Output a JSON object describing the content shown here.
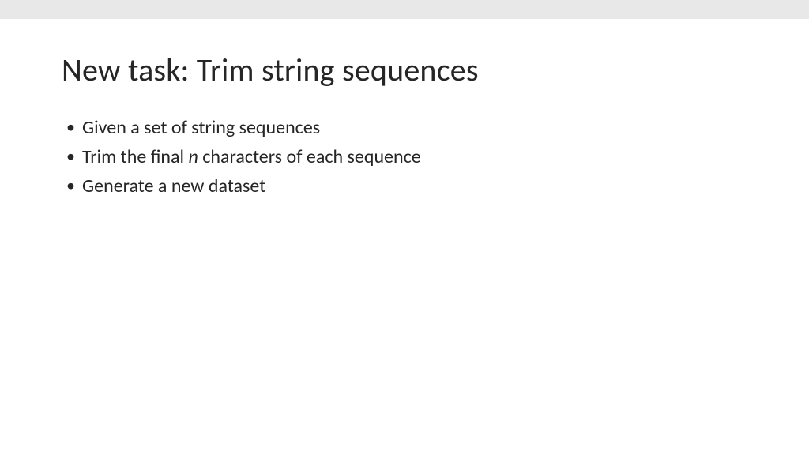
{
  "slide": {
    "title": "New task: Trim string sequences",
    "bullets": [
      {
        "textBefore": "Given a set of string sequences",
        "var": "",
        "textAfter": ""
      },
      {
        "textBefore": "Trim the final ",
        "var": "n",
        "textAfter": " characters of each sequence"
      },
      {
        "textBefore": "Generate a new dataset",
        "var": "",
        "textAfter": ""
      }
    ]
  }
}
